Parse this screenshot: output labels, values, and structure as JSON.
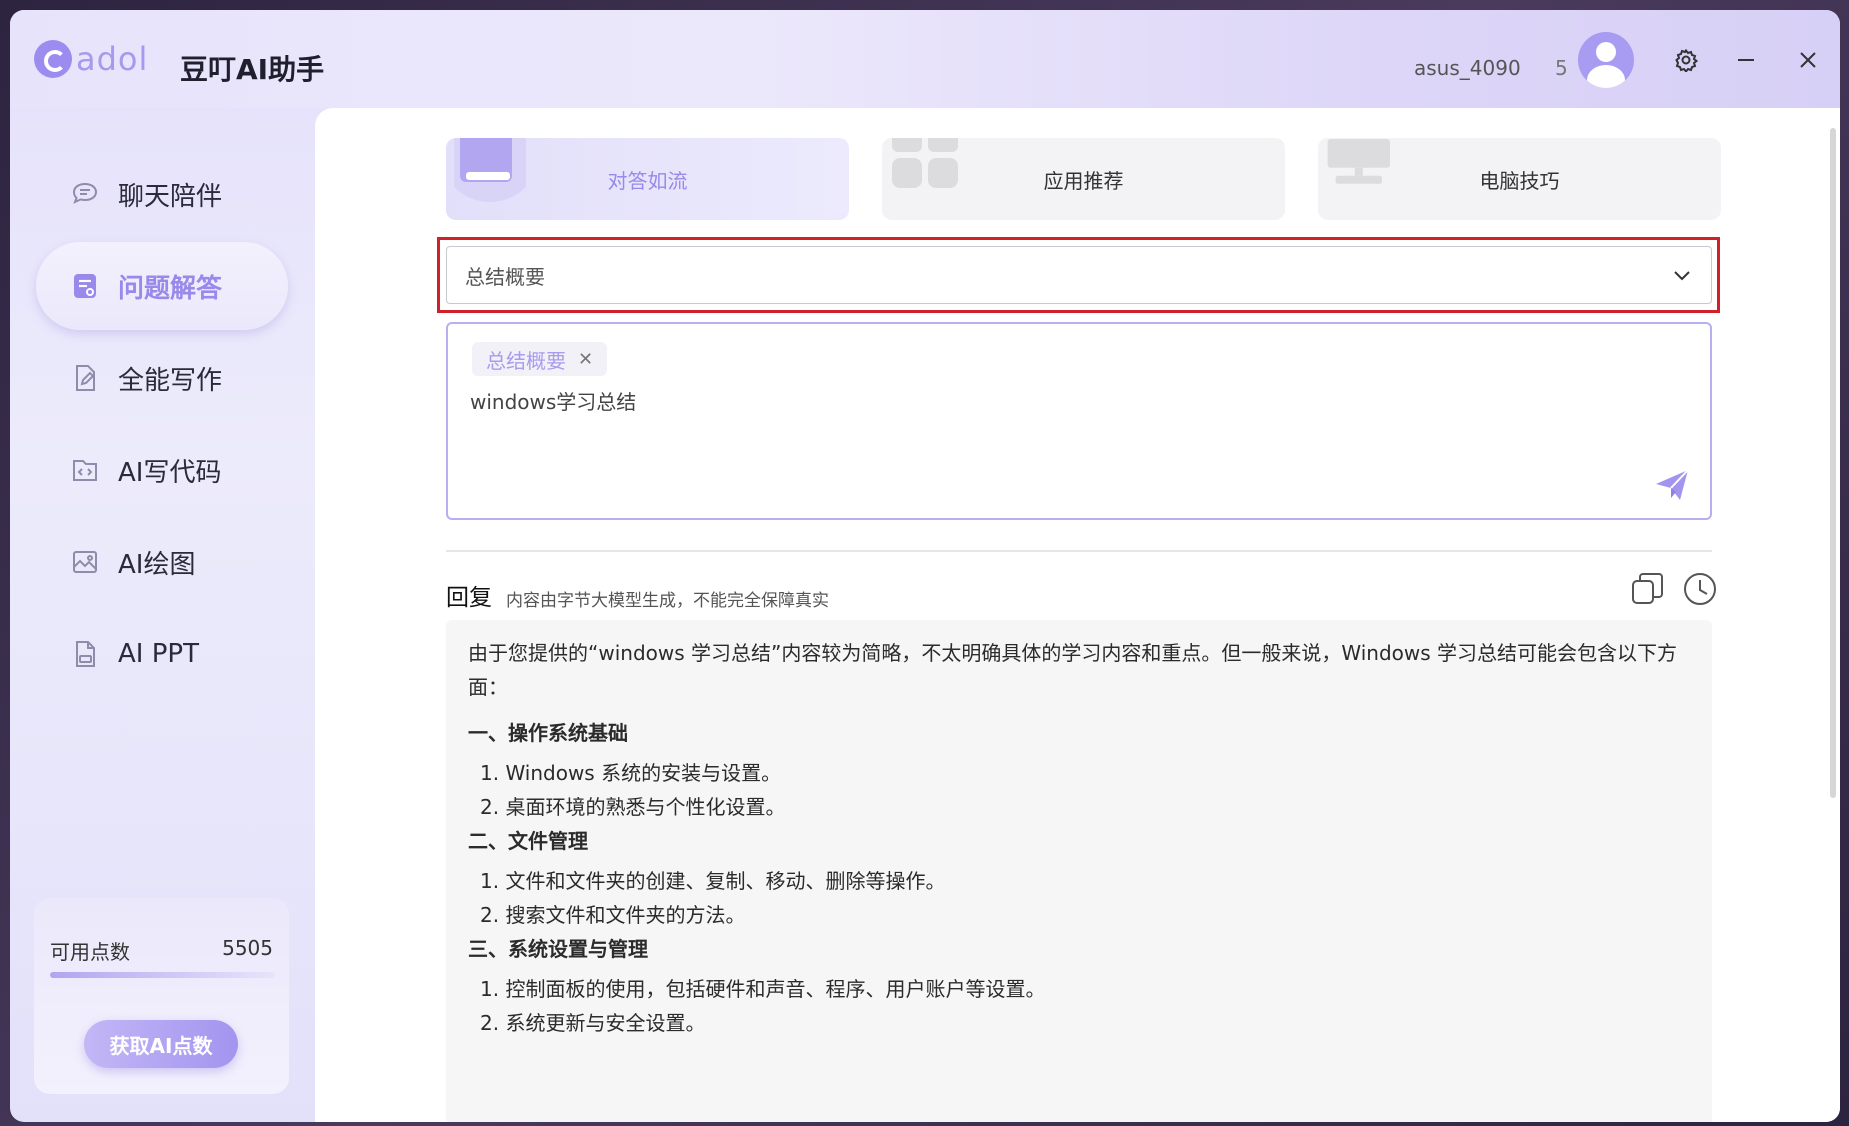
{
  "app": {
    "logo_text": "adol",
    "title": "豆叮AI助手",
    "user_name": "asus_4090",
    "user_name_extra": "5"
  },
  "sidebar": {
    "items": [
      {
        "label": "聊天陪伴",
        "icon": "chat-icon",
        "active": false
      },
      {
        "label": "问题解答",
        "icon": "qa-icon",
        "active": true
      },
      {
        "label": "全能写作",
        "icon": "write-icon",
        "active": false
      },
      {
        "label": "AI写代码",
        "icon": "code-icon",
        "active": false
      },
      {
        "label": "AI绘图",
        "icon": "image-icon",
        "active": false
      },
      {
        "label": "AI PPT",
        "icon": "ppt-icon",
        "active": false
      }
    ],
    "points": {
      "label": "可用点数",
      "value": "5505",
      "button": "获取AI点数"
    }
  },
  "tabs": [
    {
      "label": "对答如流",
      "active": true
    },
    {
      "label": "应用推荐",
      "active": false
    },
    {
      "label": "电脑技巧",
      "active": false
    }
  ],
  "select": {
    "value": "总结概要"
  },
  "editor": {
    "chip": "总结概要",
    "text": "windows学习总结"
  },
  "reply": {
    "title": "回复",
    "note": "内容由字节大模型生成，不能完全保障真实",
    "intro": "由于您提供的“windows 学习总结”内容较为简略，不太明确具体的学习内容和重点。但一般来说，Windows 学习总结可能会包含以下方面：",
    "sections": [
      {
        "heading": "一、操作系统基础",
        "items": [
          "1. Windows 系统的安装与设置。",
          "2. 桌面环境的熟悉与个性化设置。"
        ]
      },
      {
        "heading": "二、文件管理",
        "items": [
          "1. 文件和文件夹的创建、复制、移动、删除等操作。",
          "2. 搜索文件和文件夹的方法。"
        ]
      },
      {
        "heading": "三、系统设置与管理",
        "items": [
          "1. 控制面板的使用，包括硬件和声音、程序、用户账户等设置。",
          "2. 系统更新与安全设置。"
        ]
      }
    ]
  },
  "colors": {
    "accent": "#9889ea",
    "highlight_border": "#d0202a"
  }
}
